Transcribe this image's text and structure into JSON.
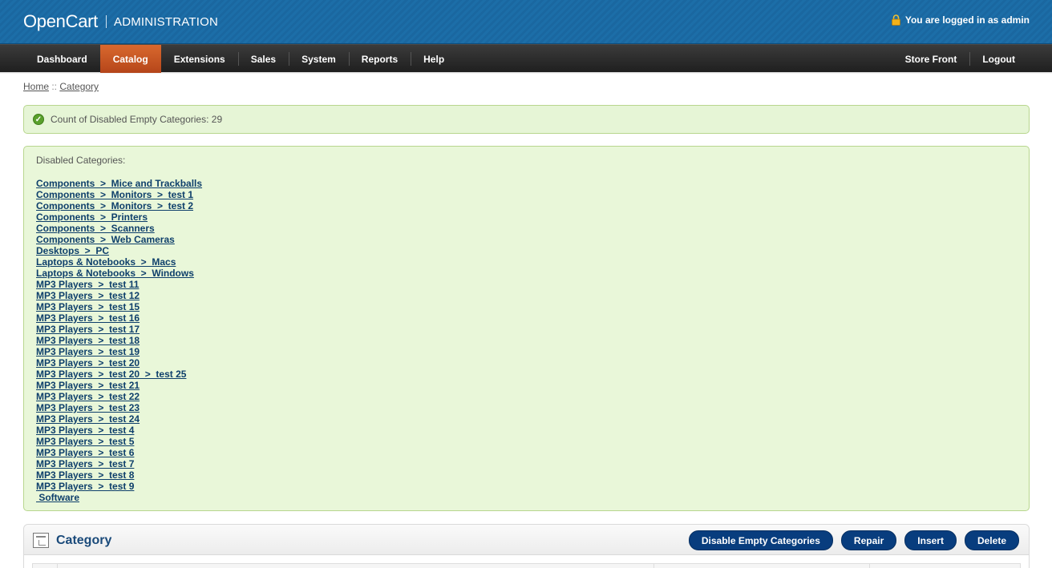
{
  "header": {
    "brand": "OpenCart",
    "subtitle": "ADMINISTRATION",
    "login_text": "You are logged in as admin",
    "lock_icon": "lock-icon"
  },
  "menu": {
    "left": [
      {
        "label": "Dashboard",
        "active": false
      },
      {
        "label": "Catalog",
        "active": true
      },
      {
        "label": "Extensions",
        "active": false
      },
      {
        "label": "Sales",
        "active": false
      },
      {
        "label": "System",
        "active": false
      },
      {
        "label": "Reports",
        "active": false
      },
      {
        "label": "Help",
        "active": false
      }
    ],
    "right": [
      {
        "label": "Store Front"
      },
      {
        "label": "Logout"
      }
    ]
  },
  "breadcrumb": {
    "home": "Home",
    "separator": " :: ",
    "current": "Category"
  },
  "success": {
    "icon": "check-circle-icon",
    "message": "Count of Disabled Empty Categories: 29"
  },
  "disabled": {
    "heading": "Disabled Categories:",
    "items": [
      "Components  >  Mice and Trackballs",
      "Components  >  Monitors  >  test 1",
      "Components  >  Monitors  >  test 2",
      "Components  >  Printers",
      "Components  >  Scanners",
      "Components  >  Web Cameras",
      "Desktops  >  PC",
      "Laptops & Notebooks  >  Macs",
      "Laptops & Notebooks  >  Windows",
      "MP3 Players  >  test 11",
      "MP3 Players  >  test 12",
      "MP3 Players  >  test 15",
      "MP3 Players  >  test 16",
      "MP3 Players  >  test 17",
      "MP3 Players  >  test 18",
      "MP3 Players  >  test 19",
      "MP3 Players  >  test 20",
      "MP3 Players  >  test 20  >  test 25",
      "MP3 Players  >  test 21",
      "MP3 Players  >  test 22",
      "MP3 Players  >  test 23",
      "MP3 Players  >  test 24",
      "MP3 Players  >  test 4",
      "MP3 Players  >  test 5",
      "MP3 Players  >  test 6",
      "MP3 Players  >  test 7",
      "MP3 Players  >  test 8",
      "MP3 Players  >  test 9",
      " Software"
    ]
  },
  "box": {
    "title": "Category",
    "icon": "category-icon",
    "buttons": {
      "disable_empty": "Disable Empty Categories",
      "repair": "Repair",
      "insert": "Insert",
      "delete": "Delete"
    }
  },
  "colors": {
    "header_blue": "#1b6aa3",
    "menu_dark": "#2b2b2b",
    "menu_active": "#c9561f",
    "success_bg": "#e6f5d6",
    "link": "#0e3f6b",
    "button": "#083d7e"
  }
}
